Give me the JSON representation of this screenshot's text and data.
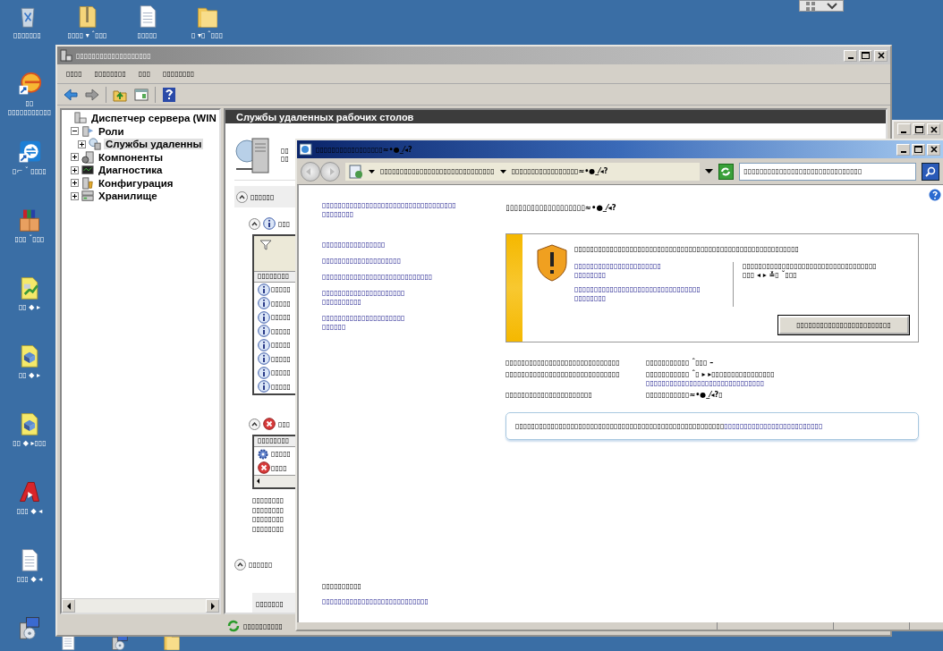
{
  "desktop": {
    "top_row": [
      {
        "kind": "trash",
        "label": "▯▯▯▯▯▯▯"
      },
      {
        "kind": "zip-folder",
        "label": "▯▯▯▯ ▾ ˆ▯▯▯"
      },
      {
        "kind": "document",
        "label": "▯▯▯▯▯"
      },
      {
        "kind": "folder",
        "label": "▯ ▾▯ ˆ▯▯▯"
      }
    ],
    "left_column": [
      {
        "kind": "disc-app",
        "label": "▯▯\n▯▯▯▯▯▯▯▯▯▯▯"
      },
      {
        "kind": "arrows-app",
        "label": "▯⌐ ˇ ▯▯▯▯"
      },
      {
        "kind": "package",
        "label": "▯▯▯ ˇ▯▯▯"
      },
      {
        "kind": "chart-file",
        "label": "▯▯ ◆ ▸"
      },
      {
        "kind": "box-file",
        "label": "▯▯ ◆ ▸"
      },
      {
        "kind": "box-file",
        "label": "▯▯ ◆ ▸▯▯▯"
      },
      {
        "kind": "red-app",
        "label": "▯▯▯ ◆ ◂"
      },
      {
        "kind": "document",
        "label": "▯▯▯ ◆ ◂"
      },
      {
        "kind": "setup"
      }
    ],
    "bottom_row": [
      {
        "kind": "document"
      },
      {
        "kind": "setup"
      },
      {
        "kind": "folder"
      }
    ]
  },
  "server_manager": {
    "title": "▯▯▯▯▯▯▯▯▯▯▯▯▯▯▯▯▯▯▯",
    "menu": [
      "▯▯▯▯",
      "▯▯▯▯▯▯▯▯",
      "▯▯▯",
      "▯▯▯▯▯▯▯▯"
    ],
    "tree": [
      {
        "label": "Диспетчер сервера (WIN",
        "kind": "server",
        "selected": false,
        "children": [
          {
            "label": "Роли",
            "kind": "roles",
            "expanded": true,
            "selected": false,
            "children": [
              {
                "label": "Службы удаленны",
                "kind": "remote",
                "expanded": false,
                "selected": true
              }
            ]
          },
          {
            "label": "Компоненты",
            "kind": "components",
            "expanded": false,
            "selected": false
          },
          {
            "label": "Диагностика",
            "kind": "diagnostics",
            "expanded": false,
            "selected": false
          },
          {
            "label": "Конфигурация",
            "kind": "config",
            "expanded": false,
            "selected": false
          },
          {
            "label": "Хранилище",
            "kind": "storage",
            "expanded": false,
            "selected": false
          }
        ]
      }
    ],
    "header": "Службы удаленных рабочих столов",
    "summary": [
      "▯▯",
      "▯▯"
    ],
    "panel": [
      {
        "kind": "toggle",
        "label": "▯▯▯▯▯▯",
        "expanded": true
      },
      {
        "kind": "info-toggle",
        "label": "▯▯▯",
        "expanded": true
      },
      {
        "kind": "table",
        "filter": true,
        "scrollbar": false,
        "header": "▯▯▯▯▯▯▯▯",
        "rows": [
          {
            "kind": "info",
            "label": "▯▯▯▯▯"
          },
          {
            "kind": "info",
            "label": "▯▯▯▯▯"
          },
          {
            "kind": "info",
            "label": "▯▯▯▯▯"
          },
          {
            "kind": "info",
            "label": "▯▯▯▯▯"
          },
          {
            "kind": "info",
            "label": "▯▯▯▯▯"
          },
          {
            "kind": "info",
            "label": "▯▯▯▯▯"
          },
          {
            "kind": "info",
            "label": "▯▯▯▯▯"
          },
          {
            "kind": "info",
            "label": "▯▯▯▯▯"
          }
        ]
      },
      {
        "kind": "error-toggle",
        "label": "▯▯▯",
        "expanded": true
      },
      {
        "kind": "table",
        "filter": false,
        "scrollbar": true,
        "header": "▯▯▯▯▯▯▯▯",
        "rows": [
          {
            "kind": "gear",
            "label": "▯▯▯▯▯"
          },
          {
            "kind": "error",
            "label": "▯▯▯▯"
          }
        ]
      },
      {
        "kind": "text",
        "label": "▯▯▯▯▯▯▯▯"
      },
      {
        "kind": "text",
        "label": "▯▯▯▯▯▯▯▯"
      },
      {
        "kind": "text",
        "label": "▯▯▯▯▯▯▯▯"
      },
      {
        "kind": "text",
        "label": "▯▯▯▯▯▯▯▯"
      },
      {
        "kind": "toggle",
        "label": "▯▯▯▯▯▯",
        "expanded": true
      },
      {
        "kind": "band",
        "label": "▯▯▯▯▯▯▯"
      }
    ],
    "status": "▯▯▯▯▯▯▯▯▯▯"
  },
  "browser": {
    "title": "▯▯▯▯▯▯▯▯▯▯▯▯▯▯▯▯▯≈•●_⁄◂?",
    "address": [
      "▯▯▯▯▯▯▯▯▯▯▯▯▯▯▯▯▯▯▯▯▯▯▯▯▯▯▯▯▯",
      "▯▯▯▯▯▯▯▯▯▯▯▯▯▯▯▯▯≈•●_⁄◂?"
    ],
    "search_placeholder": "▯▯▯▯▯▯▯▯▯▯▯▯▯▯▯▯▯▯▯▯▯▯▯▯▯▯▯▯▯▯",
    "links": [
      "▯▯▯▯▯▯▯▯▯▯▯▯▯▯▯▯▯▯▯▯▯▯▯▯▯▯▯▯▯▯▯▯▯▯\n▯▯▯▯▯▯▯▯",
      "▯▯▯▯▯▯▯▯▯▯▯▯▯▯▯▯",
      "▯▯▯▯▯▯▯▯▯▯▯▯▯▯▯▯▯▯▯▯",
      "▯▯▯▯▯▯▯▯▯▯▯▯▯▯▯▯▯▯▯▯▯▯▯▯▯▯▯▯",
      "▯▯▯▯▯▯▯▯▯▯▯▯▯▯▯▯▯▯▯▯▯\n▯▯▯▯▯▯▯▯▯▯",
      "▯▯▯▯▯▯▯▯▯▯▯▯▯▯▯▯▯▯▯▯▯\n▯▯▯▯▯▯"
    ],
    "heading": "▯▯▯▯▯▯▯▯▯▯▯▯▯▯▯▯▯▯▯≈•●_⁄◂?",
    "warning": {
      "title": "▯▯▯▯▯▯▯▯▯▯▯▯▯▯▯▯▯▯▯▯▯▯▯▯▯▯▯▯▯▯▯▯▯▯▯▯▯▯▯▯▯▯▯▯▯▯▯▯▯▯▯▯▯▯▯▯▯",
      "links": [
        "▯▯▯▯▯▯▯▯▯▯▯▯▯▯▯▯▯▯▯▯▯▯\n▯▯▯▯▯▯▯▯",
        "▯▯▯▯▯▯▯▯▯▯▯▯▯▯▯▯▯▯▯▯▯▯▯▯▯▯▯▯▯▯▯▯\n▯▯▯▯▯▯▯▯"
      ],
      "note": "▯▯▯▯▯▯▯▯▯▯▯▯▯▯▯▯▯▯▯▯▯▯▯▯▯▯▯▯▯▯▯▯▯▯\n▯▯▯ ◂ ▸ ≚▯ ˇ▯▯▯",
      "button": "▯▯▯▯▯▯▯▯▯▯▯▯▯▯▯▯▯▯▯▯▯▯▯▯"
    },
    "details": [
      {
        "label": "▯▯▯▯▯▯▯▯▯▯▯▯▯▯▯▯▯▯▯▯▯▯▯▯▯▯▯▯▯",
        "value": "▯▯▯▯▯▯▯▯▯▯▯ ˆ▯▯▯ –"
      },
      {
        "label": "▯▯▯▯▯▯▯▯▯▯▯▯▯▯▯▯▯▯▯▯▯▯▯▯▯▯▯▯▯",
        "value": "▯▯▯▯▯▯▯▯▯▯▯ ˆ▯ ▸ ▸▯▯▯▯▯▯▯▯▯▯▯▯▯▯▯▯",
        "link": "▯▯▯▯▯▯▯▯▯▯▯▯▯▯▯▯▯▯▯▯▯▯▯▯▯▯▯▯▯▯"
      },
      {
        "label": "▯▯▯▯▯▯▯▯▯▯▯▯▯▯▯▯▯▯▯▯▯▯",
        "value": "▯▯▯▯▯▯▯▯▯▯▯≈•●_⁄◂?▯"
      }
    ],
    "info": {
      "text": "▯▯▯▯▯▯▯▯▯▯▯▯▯▯▯▯▯▯▯▯▯▯▯▯▯▯▯▯▯▯▯▯▯▯▯▯▯▯▯▯▯▯▯▯▯▯▯▯▯▯▯▯▯",
      "link": "▯▯▯▯▯▯▯▯▯▯▯▯▯▯▯▯▯▯▯▯▯▯▯▯▯"
    },
    "footer": {
      "heading": "▯▯▯▯▯▯▯▯▯▯",
      "link": "▯▯▯▯▯▯▯▯▯▯▯▯▯▯▯▯▯▯▯▯▯▯▯▯▯▯▯"
    }
  }
}
